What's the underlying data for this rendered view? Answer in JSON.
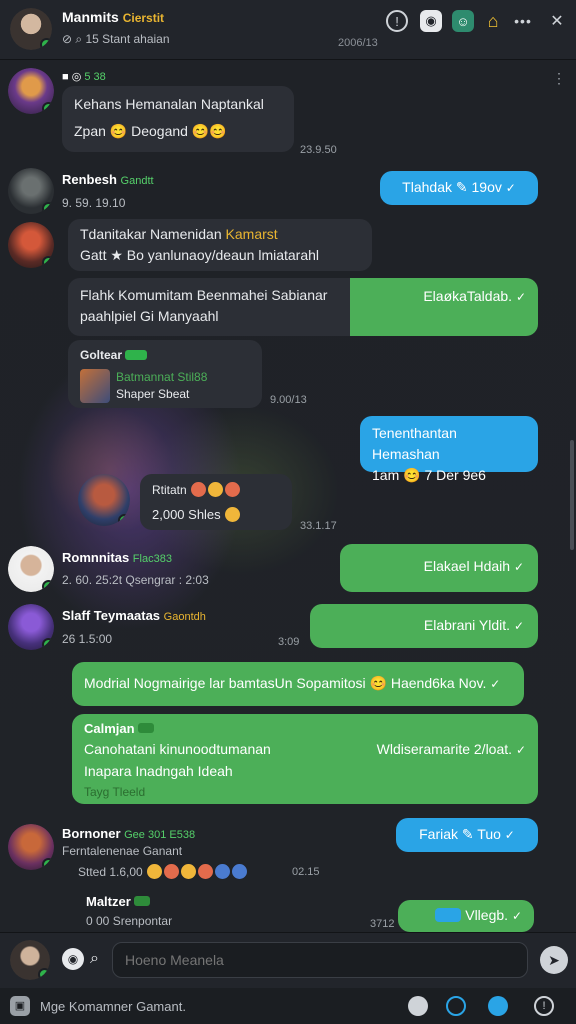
{
  "header": {
    "name": "Manmits",
    "name_badge": "Cierstit",
    "subtitle": "15 Stant ahaian",
    "time": "2006/13"
  },
  "messages": {
    "m1": {
      "sender_badge": "5 38",
      "line1": "Kehans Hemanalan Naptankal",
      "line2": "Zpan 😊 Deogand 😊😊",
      "time": "23.9.50"
    },
    "m2": {
      "name": "Renbesh",
      "badge": "Gandtt",
      "meta": "9. 59. 19.10",
      "reply_label": "Tlahdak",
      "reply_time": "19ov"
    },
    "m3": {
      "line1": "Tdanitakar Namenidan",
      "line1_accent": "Kamarst",
      "line2": "Gatt ★ Bo yanlunaoy/deaun lmiatarahl"
    },
    "m4": {
      "line1": "Flahk Komumitam Beenmahei Sabianar",
      "line2": "paahlpiel Gi Manyaahl",
      "right_text": "ElaøkaTaldab."
    },
    "m5": {
      "name": "Goltear",
      "quote_line1": "Batmannat Stil88",
      "quote_line2": "Shaper Sbeat",
      "time": "9.00/13"
    },
    "m6": {
      "line1": "Tenenthantan Hemashan",
      "line2": "1am 😊 7 Der 9e6"
    },
    "m7": {
      "title": "Rtitatn",
      "line2": "2,000 Shles",
      "time": "33.1.17"
    },
    "m8": {
      "name": "Romnnitas",
      "badge": "Flac383",
      "meta": "2. 60. 25:2t Qsengrar : 2:03",
      "out": "Elakael Hdaih"
    },
    "m9": {
      "name": "Slaff Teymaatas",
      "badge": "Gaontdh",
      "meta": "26 1.5:00",
      "time": "3:09",
      "out": "Elabrani Yldit."
    },
    "m10": {
      "text": "Modrial Nogmairige lar bamtasUn Sopamitosi 😊 Haend6ka Nov."
    },
    "m11": {
      "name": "Calmjan",
      "line1": "Canohatani kinunoodtumanan",
      "line1_right": "Wldiseramarite 2/loat.",
      "line2": "Inapara Inadngah Ideah",
      "footer": "Tayg Tleeld"
    },
    "m12": {
      "name": "Bornoner",
      "badge": "Gee 301 E538",
      "sub": "Ferntalenenae Ganant",
      "meta": "Stted 1.6,00",
      "time": "02.15",
      "reply_label": "Fariak",
      "reply_time": "Tuo"
    },
    "m13": {
      "name": "Maltzer",
      "meta": "0 00 Srenpontar",
      "time": "3712",
      "out": "Vllegb."
    }
  },
  "composer": {
    "placeholder": "Hoeno Meanela"
  },
  "bottom": {
    "text": "Mge Komamner Gamant."
  },
  "icons": [
    "timer-icon",
    "camera-icon",
    "sticker-icon",
    "bell-icon",
    "more-icon",
    "close-icon",
    "send-icon"
  ]
}
